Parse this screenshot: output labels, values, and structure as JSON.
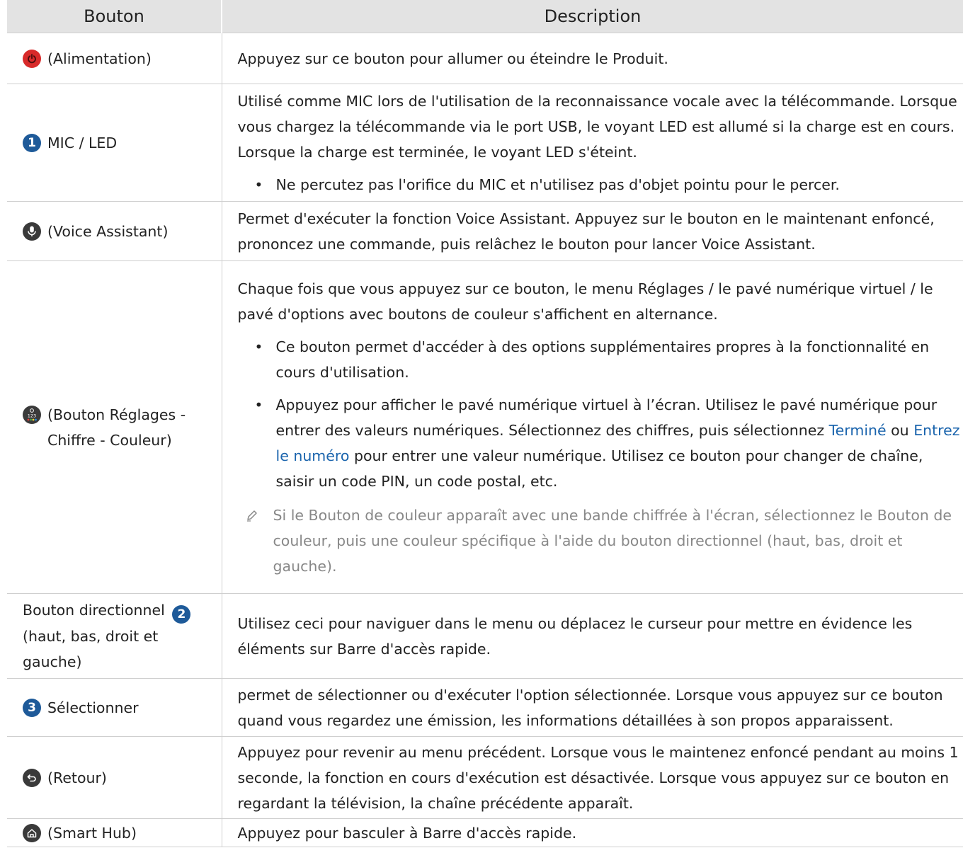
{
  "header": {
    "col1": "Bouton",
    "col2": "Description"
  },
  "colors": {
    "power": "#d82a2a",
    "icon_dark": "#3a3a3a",
    "number_badge": "#1e5a99",
    "link": "#1a64ad",
    "note": "#888888"
  },
  "rows": [
    {
      "icon": "power-icon",
      "label": "(Alimentation)",
      "desc": "Appuyez sur ce bouton pour allumer ou éteindre le Produit."
    },
    {
      "icon": "number-1-badge",
      "badge": "1",
      "label": "MIC / LED",
      "desc": "Utilisé comme MIC lors de l'utilisation de la reconnaissance vocale avec la télécommande. Lorsque vous chargez la télécommande via le port USB, le voyant LED est allumé si la charge est en cours. Lorsque la charge est terminée, le voyant LED s'éteint.",
      "bullet": "Ne percutez pas l'orifice du MIC et n'utilisez pas d'objet pointu pour le percer."
    },
    {
      "icon": "microphone-icon",
      "label": "(Voice Assistant)",
      "desc": "Permet d'exécuter la fonction Voice Assistant. Appuyez sur le bouton en le maintenant enfoncé, prononcez une commande, puis relâchez le bouton pour lancer Voice Assistant."
    },
    {
      "icon": "settings-number-color-icon",
      "label_line1": "(Bouton Réglages -",
      "label_line2": "Chiffre - Couleur)",
      "desc": "Chaque fois que vous appuyez sur ce bouton, le menu Réglages / le pavé numérique virtuel / le pavé d'options avec boutons de couleur s'affichent en alternance.",
      "bullet1": "Ce bouton permet d'accéder à des options supplémentaires propres à la fonctionnalité en cours d'utilisation.",
      "bullet2_a": "Appuyez pour afficher le pavé numérique virtuel à l’écran. Utilisez le pavé numérique pour entrer des valeurs numériques. Sélectionnez des chiffres, puis sélectionnez ",
      "bullet2_link1": "Terminé",
      "bullet2_b": " ou ",
      "bullet2_link2": "Entrez le numéro",
      "bullet2_c": " pour entrer une valeur numérique. Utilisez ce bouton pour changer de chaîne, saisir un code PIN, un code postal, etc.",
      "note": "Si le Bouton de couleur apparaît avec une bande chiffrée à l'écran, sélectionnez le Bouton de couleur, puis une couleur spécifique à l'aide du bouton directionnel (haut, bas, droit et gauche)."
    },
    {
      "icon": "number-2-badge",
      "badge": "2",
      "label_line1": "Bouton directionnel",
      "label_line2": "(haut, bas, droit et",
      "label_line3": "gauche)",
      "desc": "Utilisez ceci pour naviguer dans le menu ou déplacez le curseur pour mettre en évidence les éléments sur Barre d'accès rapide."
    },
    {
      "icon": "number-3-badge",
      "badge": "3",
      "label": "Sélectionner",
      "desc": "permet de sélectionner ou d'exécuter l'option sélectionnée. Lorsque vous appuyez sur ce bouton quand vous regardez une émission, les informations détaillées à son propos apparaissent."
    },
    {
      "icon": "return-icon",
      "label": "(Retour)",
      "desc": "Appuyez pour revenir au menu précédent. Lorsque vous le maintenez enfoncé pendant au moins 1 seconde, la fonction en cours d'exécution est désactivée. Lorsque vous appuyez sur ce bouton en regardant la télévision, la chaîne précédente apparaît."
    },
    {
      "icon": "home-icon",
      "label": "(Smart Hub)",
      "desc": "Appuyez pour basculer à Barre d'accès rapide."
    }
  ]
}
